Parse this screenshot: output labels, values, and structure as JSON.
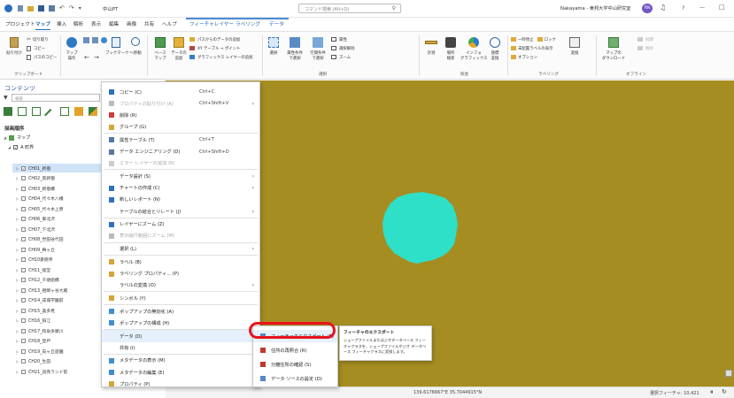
{
  "titlebar": {
    "project": "中山PT",
    "search_placeholder": "コマンド検索 (Alt+Q)",
    "user": "Nakayama - 東邦大学中山研究室",
    "user_initials": "RN",
    "help": "?",
    "minimize": "—",
    "maximize": "□"
  },
  "menubar": {
    "tabs": [
      "プロジェクト",
      "マップ",
      "挿入",
      "解析",
      "表示",
      "編集",
      "画像",
      "共有",
      "ヘルプ",
      "フィーチャレイヤー",
      "ラベリング",
      "データ"
    ],
    "active": "マップ"
  },
  "ribbon": {
    "clipboard": {
      "cut": "切り取り",
      "paste": "貼り付け",
      "copy": "コピー",
      "copy_path": "パスのコピー",
      "group": "クリップボード"
    },
    "navigate": {
      "map": "マップ",
      "operate": "操作",
      "bookmark": "ブックマーク",
      "go": "へ移動",
      "group": "ナビ"
    },
    "layer": {
      "basemap": "ベース",
      "basemap2": "マップ",
      "add_data": "データの",
      "add_data2": "追加",
      "add_from_path": "パスからのデータの追加",
      "xy_point": "XY テーブル → ポイント",
      "graphics_layer": "グラフィックス レイヤーの追加"
    },
    "selection": {
      "select": "選択",
      "by_attr": "属性条件",
      "by_attr2": "で選択",
      "by_loc": "空間条件",
      "by_loc2": "で選択",
      "attributes": "属性",
      "clear": "選択解除",
      "zoom": "ズーム",
      "group": "選択"
    },
    "inquiry": {
      "measure": "計測",
      "locate": "場所",
      "locate2": "検索",
      "infographics": "インフォ",
      "infographics2": "グラフィックス",
      "coords": "座標",
      "coords2": "変換",
      "group": "照会"
    },
    "labeling": {
      "lock": "一時停止",
      "lock2": "ロック",
      "unplaced": "未配置ラベルの表示",
      "options": "オプション",
      "convert": "変換",
      "group": "ラベリング"
    },
    "offline": {
      "download": "マップの",
      "download2": "ダウンロード",
      "sync": "同期",
      "remove": "削除",
      "group": "オフライン"
    }
  },
  "contents": {
    "title": "コンテンツ",
    "search_placeholder": "検索",
    "drawing_order": "描画順序",
    "map": "マップ",
    "layer_group": "A 町界",
    "layers": [
      "CH01_新宿",
      "CH02_高新宿",
      "CH03_新宿橋",
      "CH04_代々木八幡",
      "CH05_代々木上原",
      "CH06_東北沢",
      "CH07_下北沢",
      "CH08_世田谷代田",
      "CH09_梅ヶ丘",
      "CH10豪徳寺",
      "CH11_経堂",
      "CH12_千歳船橋",
      "CH13_祖師ヶ谷大蔵",
      "CH14_成城学園前",
      "CH15_喜多見",
      "CH16_狛江",
      "CH17_和泉多摩川",
      "CH18_登戸",
      "CH19_向ヶ丘遊園",
      "CH20_生田",
      "CH21_読売ランド前"
    ]
  },
  "context_menu": {
    "items": [
      {
        "label": "コピー (C)",
        "shortcut": "Ctrl+C"
      },
      {
        "label": "プロパティの貼り付け (A)",
        "shortcut": "Ctrl+Shift+V"
      },
      {
        "label": "削除 (R)",
        "shortcut": ""
      },
      {
        "label": "グループ (G)",
        "shortcut": ""
      },
      {
        "label": "属性テーブル (T)",
        "shortcut": "Ctrl+T"
      },
      {
        "label": "データ エンジニアリング (D)",
        "shortcut": "Ctrl+Shift+D"
      },
      {
        "label": "エラー レイヤーの追加 (R)",
        "shortcut": ""
      },
      {
        "label": "データ設計 (S)",
        "shortcut": ""
      },
      {
        "label": "チャートの作成 (C)",
        "shortcut": ""
      },
      {
        "label": "新しいレポート (N)",
        "shortcut": ""
      },
      {
        "label": "テーブルの結合とリレート (J)",
        "shortcut": ""
      },
      {
        "label": "レイヤーにズーム (Z)",
        "shortcut": ""
      },
      {
        "label": "表示縮尺範囲にズーム (M)",
        "shortcut": ""
      },
      {
        "label": "選択 (L)",
        "shortcut": ""
      },
      {
        "label": "ラベル (B)",
        "shortcut": ""
      },
      {
        "label": "ラベリング プロパティ... (P)",
        "shortcut": ""
      },
      {
        "label": "ラベルの変換 (O)",
        "shortcut": ""
      },
      {
        "label": "シンボル (Y)",
        "shortcut": ""
      },
      {
        "label": "ポップアップの無効化 (A)",
        "shortcut": ""
      },
      {
        "label": "ポップアップの構成 (H)",
        "shortcut": ""
      },
      {
        "label": "データ (D)",
        "shortcut": ""
      },
      {
        "label": "共有 (I)",
        "shortcut": ""
      },
      {
        "label": "メタデータの表示 (M)",
        "shortcut": ""
      },
      {
        "label": "メタデータの編集 (E)",
        "shortcut": ""
      },
      {
        "label": "プロパティ (P)",
        "shortcut": ""
      }
    ]
  },
  "submenu": {
    "items": [
      "フィーチャのエクスポート (E)",
      "住所の再照合 (R)",
      "分離住所の確認 (S)",
      "データ ソースの設定 (D)"
    ]
  },
  "tooltip": {
    "title": "フィーチャのエクスポート",
    "body": "シェープファイルまたはジオデータベース フィーチャクラスを、シェープファイルやジオ データベース フィーチャクラスに変換します。"
  },
  "statusbar": {
    "coords": "139.6176667°E 35.7044915°N",
    "selected": "選択フィーチャ: 10,421"
  },
  "colors": {
    "map_bg": "#a58d22",
    "feature": "#2fe0c8",
    "highlight": "#e8141c",
    "accent": "#1e6fc0"
  }
}
